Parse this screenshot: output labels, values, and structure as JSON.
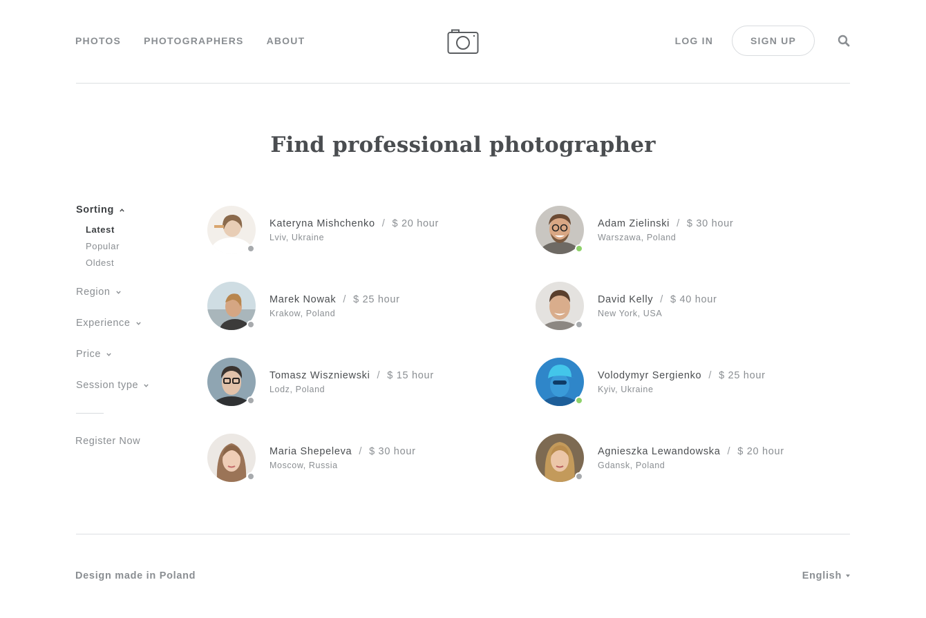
{
  "nav": {
    "links": [
      "PHOTOS",
      "PHOTOGRAPHERS",
      "ABOUT"
    ],
    "login": "LOG IN",
    "signup": "SIGN UP",
    "logo_icon": "camera-icon",
    "search_icon": "search-icon"
  },
  "page_title": "Find professional photographer",
  "sidebar": {
    "sorting": {
      "label": "Sorting",
      "options": [
        "Latest",
        "Popular",
        "Oldest"
      ],
      "selected": "Latest"
    },
    "filters": [
      "Region",
      "Experience",
      "Price",
      "Session type"
    ],
    "register": "Register Now"
  },
  "photographers": [
    {
      "name": "Kateryna Mishchenko",
      "rate": "$ 20 hour",
      "location": "Lviv, Ukraine",
      "online": false
    },
    {
      "name": "Adam Zielinski",
      "rate": "$ 30 hour",
      "location": "Warszawa, Poland",
      "online": true
    },
    {
      "name": "Marek Nowak",
      "rate": "$ 25 hour",
      "location": "Krakow, Poland",
      "online": false
    },
    {
      "name": "David Kelly",
      "rate": "$ 40 hour",
      "location": "New York, USA",
      "online": false
    },
    {
      "name": "Tomasz Wiszniewski",
      "rate": "$ 15 hour",
      "location": "Lodz, Poland",
      "online": false
    },
    {
      "name": "Volodymyr Sergienko",
      "rate": "$ 25 hour",
      "location": "Kyiv, Ukraine",
      "online": true
    },
    {
      "name": "Maria Shepeleva",
      "rate": "$ 30 hour",
      "location": "Moscow, Russia",
      "online": false
    },
    {
      "name": "Agnieszka Lewandowska",
      "rate": "$ 20 hour",
      "location": "Gdansk, Poland",
      "online": false
    }
  ],
  "footer": {
    "left": "Design made in Poland",
    "language": "English"
  },
  "colors": {
    "online": "#8ed16a",
    "offline": "#a7aaad"
  }
}
